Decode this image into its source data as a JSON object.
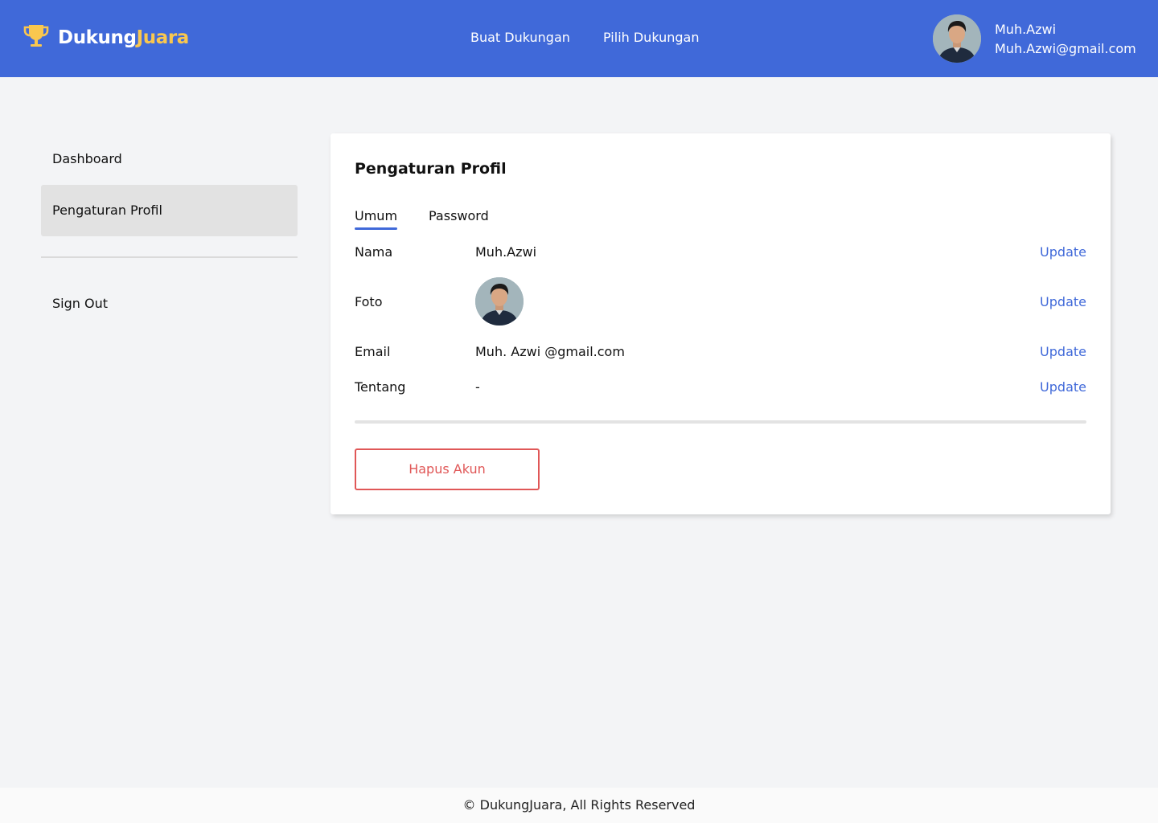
{
  "header": {
    "brand_part1": "Dukung",
    "brand_part2": "Juara",
    "nav": [
      "Buat Dukungan",
      "Pilih Dukungan"
    ],
    "user_name": "Muh.Azwi",
    "user_email": "Muh.Azwi@gmail.com",
    "logo_icon": "trophy-icon"
  },
  "sidebar": {
    "items": [
      {
        "label": "Dashboard"
      },
      {
        "label": "Pengaturan Profil",
        "active": true
      },
      {
        "label": "Sign Out"
      }
    ]
  },
  "profile": {
    "title": "Pengaturan Profil",
    "tabs": [
      {
        "label": "Umum",
        "active": true
      },
      {
        "label": "Password"
      }
    ],
    "rows": [
      {
        "label": "Nama",
        "value": "Muh.Azwi",
        "action": "Update"
      },
      {
        "label": "Foto",
        "value": "",
        "action": "Update"
      },
      {
        "label": "Email",
        "value": "Muh. Azwi @gmail.com",
        "action": "Update"
      },
      {
        "label": "Tentang",
        "value": "-",
        "action": "Update"
      }
    ],
    "delete_label": "Hapus Akun"
  },
  "footer": {
    "text": "© DukungJuara, All Rights Reserved"
  },
  "colors": {
    "primary": "#4069D9",
    "brand_accent": "#F9C74F",
    "danger": "#E05757",
    "background": "#F3F4F6"
  }
}
